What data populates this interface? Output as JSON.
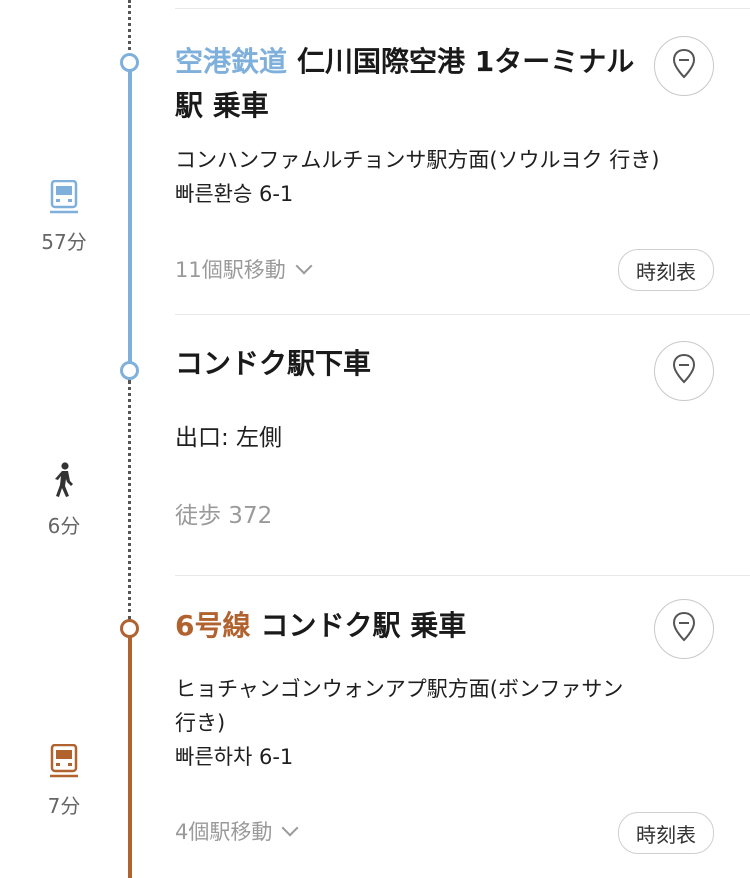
{
  "colors": {
    "airport_railroad": "#7fb0dc",
    "line6": "#b0622f",
    "walk": "#333333",
    "muted": "#9a9a9a"
  },
  "segments": [
    {
      "line_name": "空港鉄道",
      "title": "仁川国際空港 1ターミナル駅 乗車",
      "direction": "コンハンファムルチョンサ駅方面(ソウルヨク 行き)",
      "transfer": "빠른환승 6-1",
      "stops": "11個駅移動",
      "timetable_label": "時刻表",
      "mode_icon": "train-icon",
      "duration": "57分"
    },
    {
      "title": "コンドク駅下車",
      "exit": "出口: 左側",
      "walk": "徒歩 372",
      "mode_icon": "walking-person-icon",
      "duration": "6分"
    },
    {
      "line_name": "6号線",
      "title": "コンドク駅 乗車",
      "direction_line1": "ヒョチャンゴンウォンアプ駅方面(ボンファサン",
      "direction_line2": "行き)",
      "transfer": "빠른하차 6-1",
      "stops": "4個駅移動",
      "timetable_label": "時刻表",
      "mode_icon": "train-icon",
      "duration": "7分"
    }
  ]
}
